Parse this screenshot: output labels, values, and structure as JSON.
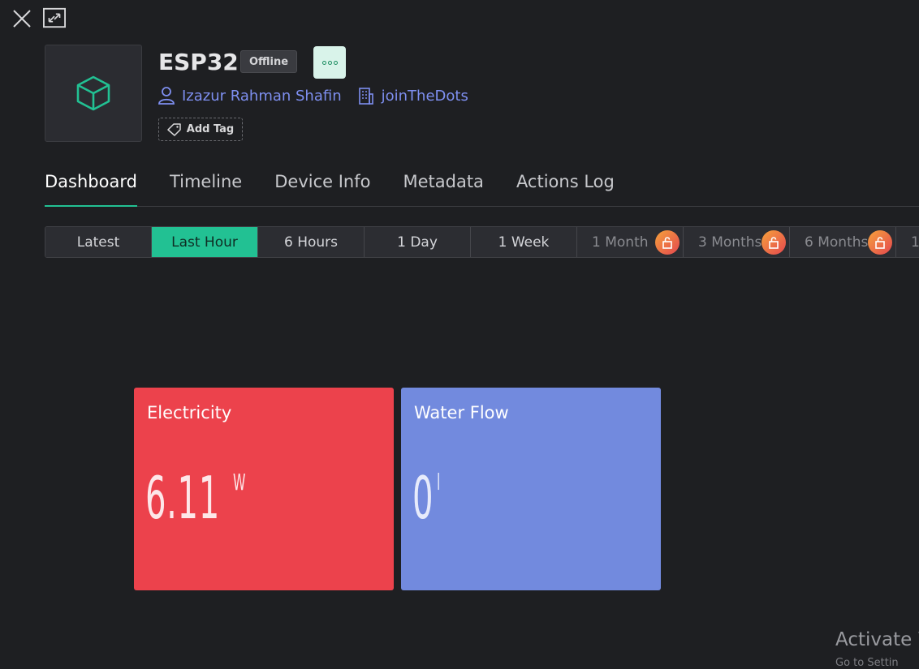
{
  "device": {
    "name": "ESP32",
    "status": "Offline",
    "owner": "Izazur Rahman Shafin",
    "organization": "joinTheDots",
    "add_tag_label": "Add Tag"
  },
  "tabs": [
    {
      "label": "Dashboard",
      "active": true
    },
    {
      "label": "Timeline"
    },
    {
      "label": "Device Info"
    },
    {
      "label": "Metadata"
    },
    {
      "label": "Actions Log"
    }
  ],
  "time_ranges": [
    {
      "label": "Latest"
    },
    {
      "label": "Last Hour",
      "active": true
    },
    {
      "label": "6 Hours"
    },
    {
      "label": "1 Day"
    },
    {
      "label": "1 Week"
    },
    {
      "label": "1 Month",
      "locked": true
    },
    {
      "label": "3 Months",
      "locked": true
    },
    {
      "label": "6 Months",
      "locked": true
    },
    {
      "label": "1"
    }
  ],
  "widgets": [
    {
      "title": "Electricity",
      "value": "6.11",
      "unit": "W",
      "color": "#ec424c"
    },
    {
      "title": "Water Flow",
      "value": "0",
      "unit": "l",
      "color": "#728ade"
    }
  ],
  "colors": {
    "accent": "#22c193",
    "link": "#7e8ff0",
    "background": "#1e1f22"
  },
  "watermark": {
    "line1": "Activate W",
    "line2": "Go to Settin"
  },
  "icons": {
    "close": "close-icon",
    "expand": "expand-icon",
    "device": "cube-icon",
    "more": "more-icon",
    "owner": "user-icon",
    "organization": "building-icon",
    "tag": "tag-icon",
    "lock": "lock-icon"
  }
}
